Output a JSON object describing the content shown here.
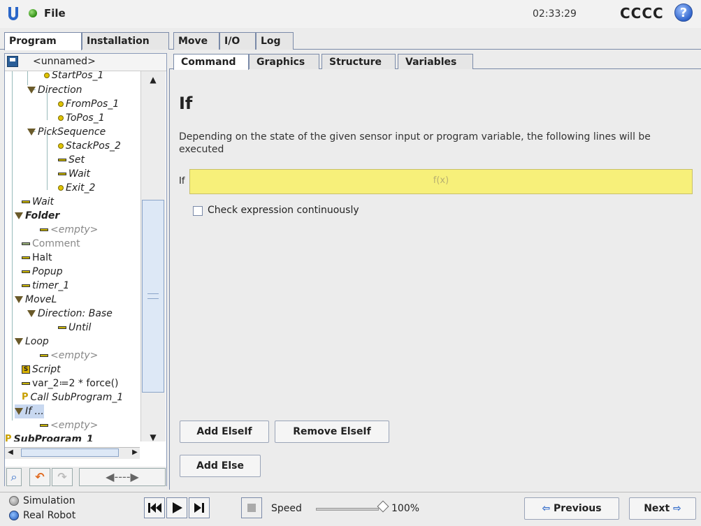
{
  "topbar": {
    "file_label": "File",
    "clock": "02:33:29",
    "robot_name": "CCCC",
    "help_symbol": "?"
  },
  "main_tabs": [
    {
      "label": "Program"
    },
    {
      "label": "Installation"
    },
    {
      "label": "Move"
    },
    {
      "label": "I/O"
    },
    {
      "label": "Log"
    }
  ],
  "program": {
    "name": "<unnamed>"
  },
  "tree": [
    {
      "label": "StartPos_1"
    },
    {
      "label": "Direction"
    },
    {
      "label": "FromPos_1"
    },
    {
      "label": "ToPos_1"
    },
    {
      "label": "PickSequence"
    },
    {
      "label": "StackPos_2"
    },
    {
      "label": "Set"
    },
    {
      "label": "Wait"
    },
    {
      "label": "Exit_2"
    },
    {
      "label": "Wait"
    },
    {
      "label": "Folder"
    },
    {
      "label": "<empty>"
    },
    {
      "label": "Comment"
    },
    {
      "label": "Halt"
    },
    {
      "label": "Popup"
    },
    {
      "label": "timer_1"
    },
    {
      "label": "MoveL"
    },
    {
      "label": "Direction: Base"
    },
    {
      "label": "Until"
    },
    {
      "label": "Loop"
    },
    {
      "label": "<empty>"
    },
    {
      "label": "Script"
    },
    {
      "label": "var_2≔2 * force()"
    },
    {
      "label": "Call SubProgram_1"
    },
    {
      "label": "If ..."
    },
    {
      "label": "<empty>"
    },
    {
      "label": "SubProgram_1"
    }
  ],
  "content_tabs": [
    {
      "label": "Command"
    },
    {
      "label": "Graphics"
    },
    {
      "label": "Structure"
    },
    {
      "label": "Variables"
    }
  ],
  "command": {
    "title": "If",
    "description": "Depending on the state of the given sensor input or program variable, the following lines will be executed",
    "if_label": "If",
    "expression_placeholder": "f(x)",
    "check_label": "Check expression continuously",
    "check_value": false,
    "add_elseif": "Add ElseIf",
    "remove_elseif": "Remove ElseIf",
    "add_else": "Add Else"
  },
  "footer": {
    "simulation": "Simulation",
    "real_robot": "Real Robot",
    "speed_label": "Speed",
    "speed_value": "100%",
    "speed_fraction": 1.0,
    "previous": "Previous",
    "next": "Next"
  },
  "colors": {
    "expression_bg": "#f7f07a",
    "accent": "#2a66c8",
    "tab_border": "#7a8aa8"
  }
}
